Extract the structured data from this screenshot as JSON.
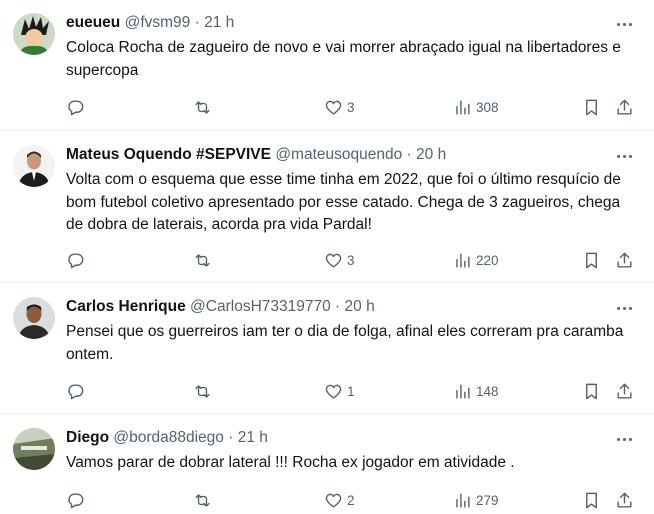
{
  "tweets": [
    {
      "name": "eueueu",
      "handle": "@fvsm99",
      "dot": "·",
      "time": "21 h",
      "text": "Coloca Rocha de zagueiro de novo e vai morrer abraçado igual na libertadores e supercopa",
      "replies": "",
      "retweets": "",
      "likes": "3",
      "views": "308",
      "avatar_icon": "anime-character-avatar",
      "avatar_colors": [
        "#cfd9c7",
        "#1b1b1b",
        "#2e7d32"
      ]
    },
    {
      "name": "Mateus Oquendo #SEPVIVE",
      "handle": "@mateusoquendo",
      "dot": "·",
      "time": "20 h",
      "text": "Volta com o esquema que esse time tinha em 2022, que foi o último resquício de bom futebol coletivo apresentado por esse catado. Chega de 3 zagueiros, chega de dobra de laterais, acorda pra vida Pardal!",
      "replies": "",
      "retweets": "",
      "likes": "3",
      "views": "220",
      "avatar_icon": "man-in-suit-avatar",
      "avatar_colors": [
        "#f3f3f3",
        "#1c1c1c",
        "#c99a7a"
      ]
    },
    {
      "name": "Carlos Henrique",
      "handle": "@CarlosH73319770",
      "dot": "·",
      "time": "20 h",
      "text": "Pensei que os guerreiros iam ter o dia de folga, afinal eles correram pra caramba ontem.",
      "replies": "",
      "retweets": "",
      "likes": "1",
      "views": "148",
      "avatar_icon": "young-man-avatar",
      "avatar_colors": [
        "#d9dde0",
        "#2a2a2a",
        "#8d5a3b"
      ]
    },
    {
      "name": "Diego",
      "handle": "@borda88diego",
      "dot": "·",
      "time": "21 h",
      "text": "Vamos parar de dobrar lateral !!! Rocha ex jogador em atividade .",
      "replies": "",
      "retweets": "",
      "likes": "2",
      "views": "279",
      "avatar_icon": "stadium-photo-avatar",
      "avatar_colors": [
        "#6f7f5a",
        "#3f4b33",
        "#a9b2a0"
      ]
    }
  ],
  "icons": {
    "reply": "reply-icon",
    "retweet": "retweet-icon",
    "like": "like-icon",
    "views": "views-icon",
    "bookmark": "bookmark-icon",
    "share": "share-icon",
    "more": "more-icon"
  },
  "colors": {
    "text": "#0f1419",
    "secondary": "#536471",
    "divider": "#eff3f4"
  }
}
